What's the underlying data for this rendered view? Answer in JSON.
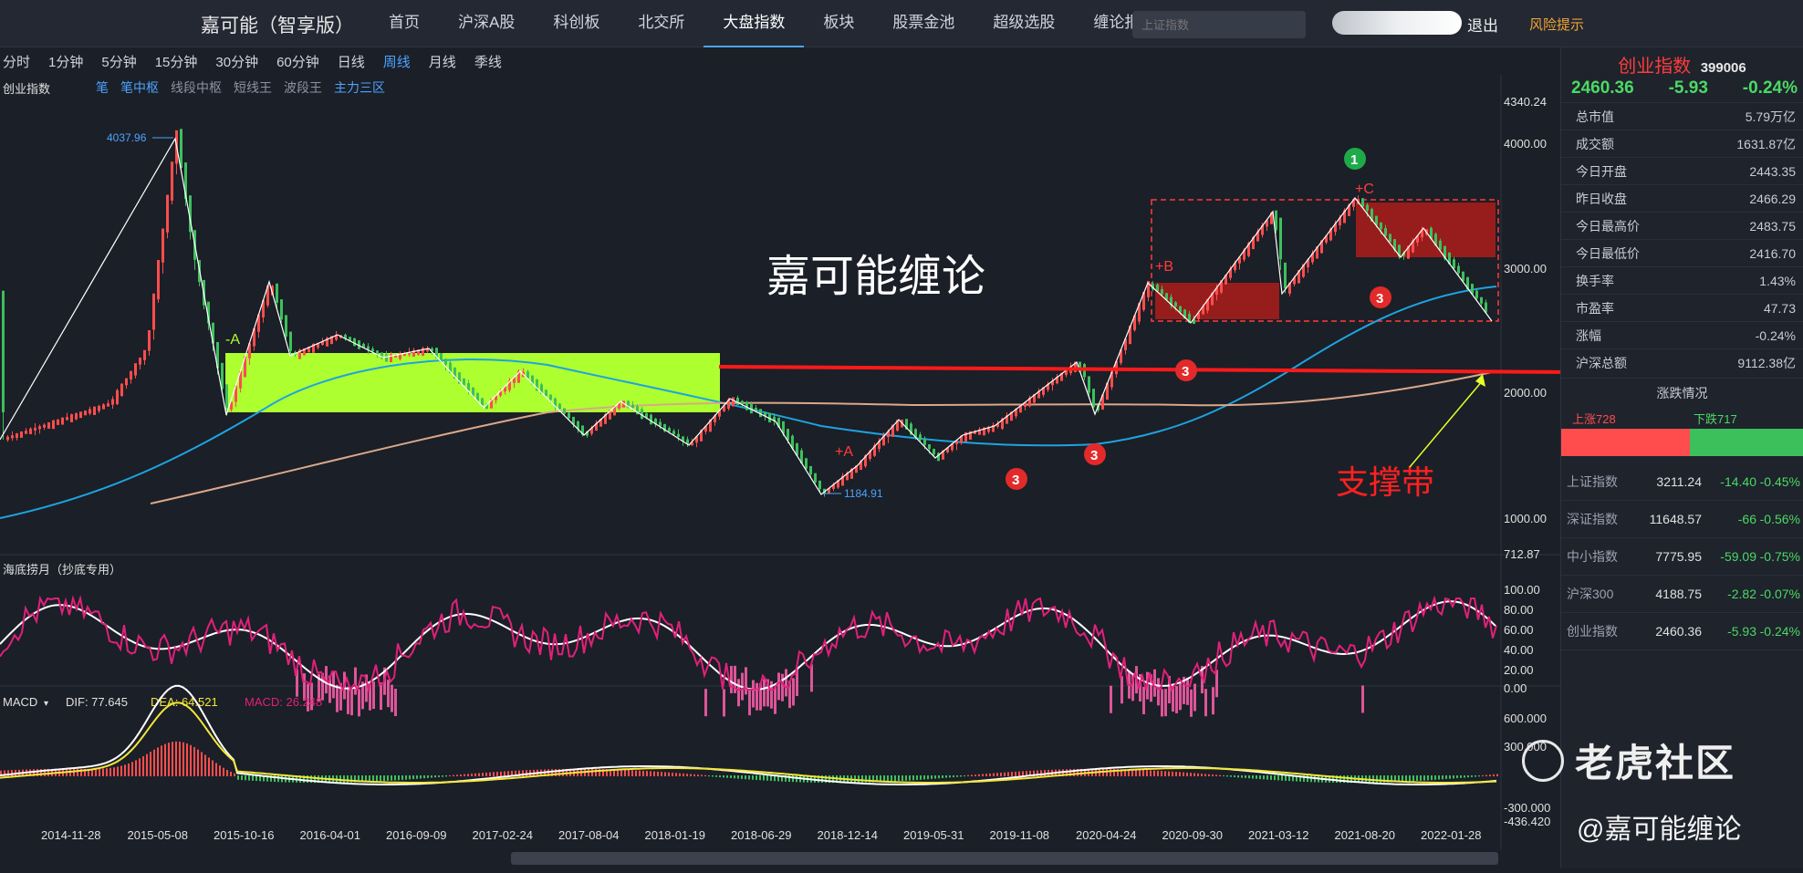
{
  "topbar": {
    "brand": "嘉可能（智享版）",
    "nav": [
      "首页",
      "沪深A股",
      "科创板",
      "北交所",
      "大盘指数",
      "板块",
      "股票金池",
      "超级选股",
      "缠论报警"
    ],
    "active_nav": 4,
    "search_placeholder": "上证指数",
    "logout": "退出",
    "risk": "风险提示"
  },
  "periods": [
    "分时",
    "1分钟",
    "5分钟",
    "15分钟",
    "30分钟",
    "60分钟",
    "日线",
    "周线",
    "月线",
    "季线"
  ],
  "active_period": 7,
  "subtabs": {
    "title": "创业指数",
    "items": [
      "笔",
      "笔中枢",
      "线段中枢",
      "短线王",
      "波段王",
      "主力三区"
    ]
  },
  "main_chart": {
    "y_ticks": [
      "4340.24",
      "4000.00",
      "3000.00",
      "2000.00",
      "1000.00",
      "712.87"
    ],
    "annotations": {
      "high_label": "4037.96",
      "low_label": "1184.91",
      "watermark_title": "嘉可能缠论",
      "support_label": "支撑带",
      "label_A": "-A",
      "label_plus_A": "+A",
      "label_B": "+B",
      "label_C": "+C",
      "badge_1": "1",
      "badge_3": "3"
    }
  },
  "oscillator": {
    "title": "海底捞月（抄底专用）",
    "y_ticks": [
      "100.00",
      "80.00",
      "60.00",
      "40.00",
      "20.00",
      "0.00"
    ]
  },
  "macd": {
    "title": "MACD",
    "dif_label": "DIF: 77.645",
    "dea_label": "DEA: 64.521",
    "macd_label": "MACD: 26.248",
    "y_ticks": [
      "600.000",
      "300.000",
      "-300.000",
      "-436.420"
    ]
  },
  "x_axis": [
    "2014-11-28",
    "2015-05-08",
    "2015-10-16",
    "2016-04-01",
    "2016-09-09",
    "2017-02-24",
    "2017-08-04",
    "2018-01-19",
    "2018-06-29",
    "2018-12-14",
    "2019-05-31",
    "2019-11-08",
    "2020-04-24",
    "2020-09-30",
    "2021-03-12",
    "2021-08-20",
    "2022-01-28"
  ],
  "side": {
    "name": "创业指数",
    "code": "399006",
    "price": "2460.36",
    "change": "-5.93",
    "pct": "-0.24%",
    "stats": [
      {
        "k": "总市值",
        "v": "5.79万亿"
      },
      {
        "k": "成交额",
        "v": "1631.87亿"
      },
      {
        "k": "今日开盘",
        "v": "2443.35"
      },
      {
        "k": "昨日收盘",
        "v": "2466.29"
      },
      {
        "k": "今日最高价",
        "v": "2483.75"
      },
      {
        "k": "今日最低价",
        "v": "2416.70"
      },
      {
        "k": "换手率",
        "v": "1.43%"
      },
      {
        "k": "市盈率",
        "v": "47.73"
      },
      {
        "k": "涨幅",
        "v": "-0.24%"
      },
      {
        "k": "沪深总额",
        "v": "9112.38亿"
      }
    ],
    "rise_title": "涨跌情况",
    "up": "上涨728",
    "down": "下跌717",
    "indices": [
      {
        "name": "上证指数",
        "val": "3211.24",
        "chg": "-14.40",
        "pct": "-0.45%"
      },
      {
        "name": "深证指数",
        "val": "11648.57",
        "chg": "-66",
        "pct": "-0.56%"
      },
      {
        "name": "中小指数",
        "val": "7775.95",
        "chg": "-59.09",
        "pct": "-0.75%"
      },
      {
        "name": "沪深300",
        "val": "4188.75",
        "chg": "-2.82",
        "pct": "-0.07%"
      },
      {
        "name": "创业指数",
        "val": "2460.36",
        "chg": "-5.93",
        "pct": "-0.24%"
      }
    ]
  },
  "watermark": {
    "site": "老虎社区",
    "author": "@嘉可能缠论"
  },
  "colors": {
    "up": "#ff4d4d",
    "down": "#4cd964",
    "accent": "#4da3ff",
    "zone": "#adff2f",
    "support": "#ff1a1a"
  }
}
